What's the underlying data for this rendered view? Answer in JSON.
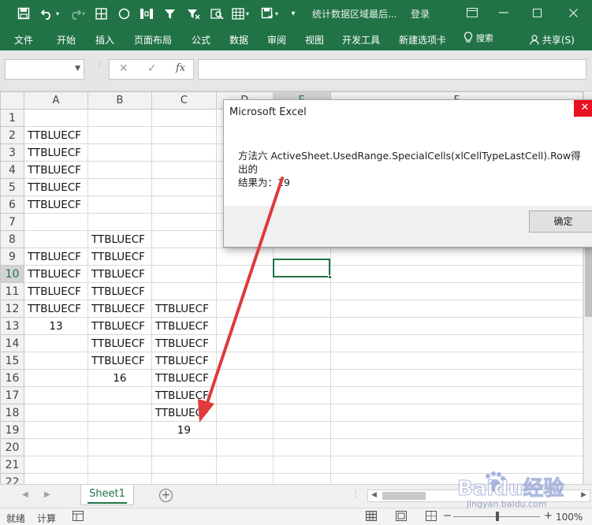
{
  "titlebar": {
    "doc_title": "统计数据区域最后...",
    "login": "登录",
    "icons": [
      "save-icon",
      "undo-icon",
      "redo-icon",
      "table-icon",
      "circle-icon",
      "column-icon",
      "filter-icon",
      "clear-filter-icon",
      "find-icon",
      "grid-icon",
      "save-as-icon",
      "customize-icon"
    ]
  },
  "ribbon": {
    "tabs": [
      "文件",
      "开始",
      "插入",
      "页面布局",
      "公式",
      "数据",
      "审阅",
      "视图",
      "开发工具",
      "新建选项卡"
    ],
    "search": "搜索",
    "share": "共享(S)"
  },
  "formula_bar": {
    "name_box": "",
    "formula": "",
    "fx_label": "fx"
  },
  "grid": {
    "columns": [
      "A",
      "B",
      "C",
      "D",
      "E",
      "F"
    ],
    "selected_column": "E",
    "selected_row": "10",
    "rows": [
      {
        "n": "1",
        "A": "",
        "B": "",
        "C": ""
      },
      {
        "n": "2",
        "A": "TTBLUECF",
        "B": "",
        "C": ""
      },
      {
        "n": "3",
        "A": "TTBLUECF",
        "B": "",
        "C": ""
      },
      {
        "n": "4",
        "A": "TTBLUECF",
        "B": "",
        "C": ""
      },
      {
        "n": "5",
        "A": "TTBLUECF",
        "B": "",
        "C": ""
      },
      {
        "n": "6",
        "A": "TTBLUECF",
        "B": "",
        "C": ""
      },
      {
        "n": "7",
        "A": "",
        "B": "",
        "C": ""
      },
      {
        "n": "8",
        "A": "",
        "B": "TTBLUECF",
        "C": ""
      },
      {
        "n": "9",
        "A": "TTBLUECF",
        "B": "TTBLUECF",
        "C": ""
      },
      {
        "n": "10",
        "A": "TTBLUECF",
        "B": "TTBLUECF",
        "C": ""
      },
      {
        "n": "11",
        "A": "TTBLUECF",
        "B": "TTBLUECF",
        "C": ""
      },
      {
        "n": "12",
        "A": "TTBLUECF",
        "B": "TTBLUECF",
        "C": "TTBLUECF"
      },
      {
        "n": "13",
        "A": "13",
        "B": "TTBLUECF",
        "C": "TTBLUECF"
      },
      {
        "n": "14",
        "A": "",
        "B": "TTBLUECF",
        "C": "TTBLUECF"
      },
      {
        "n": "15",
        "A": "",
        "B": "TTBLUECF",
        "C": "TTBLUECF"
      },
      {
        "n": "16",
        "A": "",
        "B": "16",
        "C": "TTBLUECF"
      },
      {
        "n": "17",
        "A": "",
        "B": "",
        "C": "TTBLUECF"
      },
      {
        "n": "18",
        "A": "",
        "B": "",
        "C": "TTBLUECF"
      },
      {
        "n": "19",
        "A": "",
        "B": "",
        "C": "19"
      },
      {
        "n": "20",
        "A": "",
        "B": "",
        "C": ""
      },
      {
        "n": "21",
        "A": "",
        "B": "",
        "C": ""
      },
      {
        "n": "22",
        "A": "",
        "B": "",
        "C": ""
      }
    ]
  },
  "sheet_tabs": {
    "sheets": [
      "Sheet1"
    ],
    "active": "Sheet1"
  },
  "status": {
    "ready": "就绪",
    "calc": "计算",
    "zoom": "100%"
  },
  "dialog": {
    "title": "Microsoft Excel",
    "message_line1": "方法六  ActiveSheet.UsedRange.SpecialCells(xlCellTypeLastCell).Row得出的",
    "message_line2": "结果为：19",
    "ok_label": "确定"
  },
  "watermark": {
    "brand": "Baidu经验",
    "url": "jingyan.baidu.com"
  },
  "colors": {
    "excel_green": "#217346",
    "arrow_red": "#e03a3a"
  }
}
